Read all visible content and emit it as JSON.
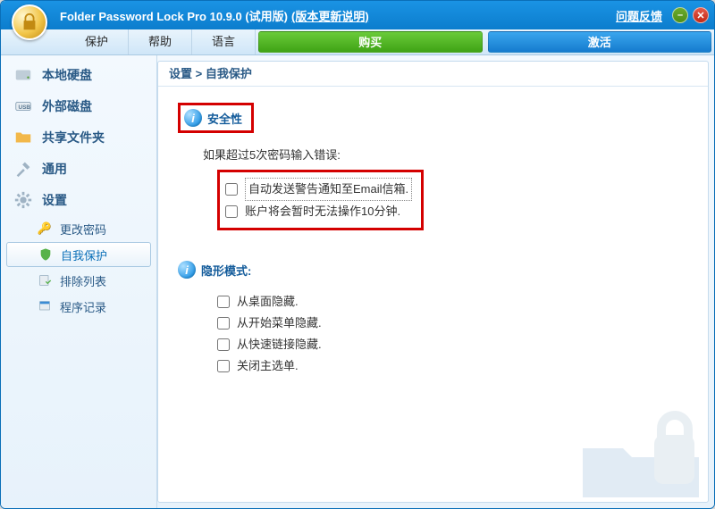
{
  "title": "Folder Password Lock Pro 10.9.0 (试用版)",
  "update_note": "(版本更新说明)",
  "feedback": "问题反馈",
  "menu": {
    "protect": "保护",
    "help": "帮助",
    "language": "语言",
    "buy": "购买",
    "activate": "激活"
  },
  "sidebar": {
    "local_disk": "本地硬盘",
    "external_disk": "外部磁盘",
    "shared_folder": "共享文件夹",
    "general": "通用",
    "settings": "设置",
    "sub": {
      "change_password": "更改密码",
      "self_protect": "自我保护",
      "exclusion_list": "排除列表",
      "program_log": "程序记录"
    }
  },
  "breadcrumb": "设置 > 自我保护",
  "security": {
    "heading": "安全性",
    "group_label": "如果超过5次密码输入错误:",
    "opt_email": "自动发送警告通知至Email信箱.",
    "opt_lock": "账户将会暂时无法操作10分钟."
  },
  "stealth": {
    "heading": "隐形模式:",
    "opt_desktop": "从桌面隐藏.",
    "opt_startmenu": "从开始菜单隐藏.",
    "opt_quicklaunch": "从快速链接隐藏.",
    "opt_mainmenu": "关闭主选单."
  }
}
